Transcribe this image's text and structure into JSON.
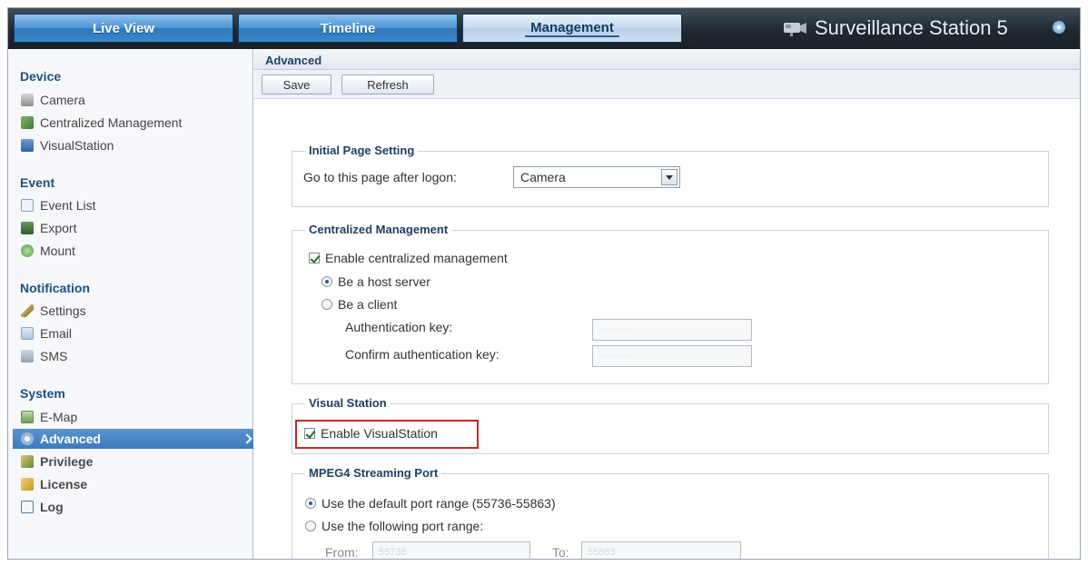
{
  "tabs": [
    {
      "label": "Live View"
    },
    {
      "label": "Timeline"
    },
    {
      "label": "Management"
    }
  ],
  "brand": {
    "title": "Surveillance Station 5"
  },
  "sidebar": {
    "groups": [
      {
        "title": "Device",
        "items": [
          {
            "label": "Camera"
          },
          {
            "label": "Centralized Management"
          },
          {
            "label": "VisualStation"
          }
        ]
      },
      {
        "title": "Event",
        "items": [
          {
            "label": "Event List"
          },
          {
            "label": "Export"
          },
          {
            "label": "Mount"
          }
        ]
      },
      {
        "title": "Notification",
        "items": [
          {
            "label": "Settings"
          },
          {
            "label": "Email"
          },
          {
            "label": "SMS"
          }
        ]
      },
      {
        "title": "System",
        "items": [
          {
            "label": "E-Map"
          },
          {
            "label": "Advanced"
          },
          {
            "label": "Privilege"
          },
          {
            "label": "License"
          },
          {
            "label": "Log"
          }
        ]
      }
    ]
  },
  "main": {
    "title": "Advanced",
    "toolbar": {
      "save": "Save",
      "refresh": "Refresh"
    },
    "initial_page": {
      "legend": "Initial Page Setting",
      "label": "Go to this page after logon:",
      "value": "Camera"
    },
    "central": {
      "legend": "Centralized Management",
      "enable": "Enable centralized management",
      "host": "Be a host server",
      "client": "Be a client",
      "auth_label": "Authentication key:",
      "auth_value": "·········",
      "confirm_label": "Confirm authentication key:",
      "confirm_value": "·········"
    },
    "visual": {
      "legend": "Visual Station",
      "enable": "Enable VisualStation"
    },
    "mpeg4": {
      "legend": "MPEG4 Streaming Port",
      "default": "Use the default port range (55736-55863)",
      "following": "Use the following port range:",
      "from_label": "From:",
      "from_value": "55736",
      "to_label": "To:",
      "to_value": "55863"
    }
  },
  "colors": {
    "accent": "#3e7bbd",
    "highlight": "#c62828"
  }
}
